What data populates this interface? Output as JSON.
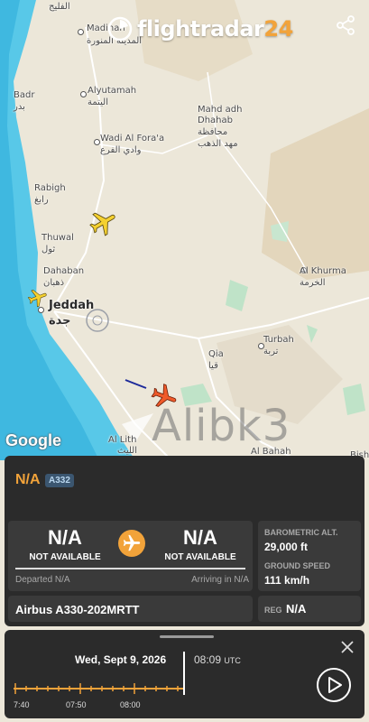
{
  "brand": {
    "name": "flightradar",
    "num": "24"
  },
  "map": {
    "labels": {
      "medina": "Madinah",
      "medina_ar": "المدينة المنورة",
      "badr": "Badr",
      "badr_ar": "بدر",
      "alyutamah": "Alyutamah",
      "alyutamah_ar": "اليتمة",
      "mahad": "Mahd adh",
      "mahad2": "Dhahab",
      "mahad_ar": "محافظة",
      "mahad_ar2": "مهد الذهب",
      "wadi": "Wadi Al Fora'a",
      "wadi_ar": "وادي الفرع",
      "rabigh": "Rabigh",
      "rabigh_ar": "رابغ",
      "thuwal": "Thuwal",
      "thuwal_ar": "ثول",
      "dahaban": "Dahaban",
      "dahaban_ar": "ذهبان",
      "jeddah": "Jeddah",
      "jeddah_ar": "جدة",
      "alkhurma": "Al Khurma",
      "alkhurma_ar": "الخرمة",
      "turbah": "Turbah",
      "turbah_ar": "تربة",
      "qia": "Qia",
      "qia_ar": "قيا",
      "allith": "Al Lith",
      "allith_ar": "الليث",
      "albahah": "Al Bahah",
      "bish": "Bish",
      "top_ar": "الفليج"
    },
    "google": "Google",
    "watermark": "Alibk3"
  },
  "flight": {
    "callsign": "N/A",
    "aircraft_code": "A332",
    "origin": {
      "code": "N/A",
      "name": "NOT AVAILABLE"
    },
    "destination": {
      "code": "N/A",
      "name": "NOT AVAILABLE"
    },
    "departed": "Departed N/A",
    "arriving": "Arriving in N/A",
    "aircraft_name": "Airbus A330-202MRTT",
    "reg_label": "REG",
    "reg": "N/A",
    "baro_label": "BAROMETRIC ALT.",
    "baro_value": "29,000 ft",
    "gs_label": "GROUND SPEED",
    "gs_value": "111 km/h"
  },
  "playback": {
    "date": "Wed, Sept 9, 2026",
    "time": "08:09",
    "tz": "UTC",
    "ticks": [
      "7:40",
      "07:50",
      "08:00"
    ]
  },
  "colors": {
    "accent": "#f2a33a",
    "panel": "#2b2b2b",
    "sea": "#58c8e8",
    "land": "#ece7d9"
  }
}
